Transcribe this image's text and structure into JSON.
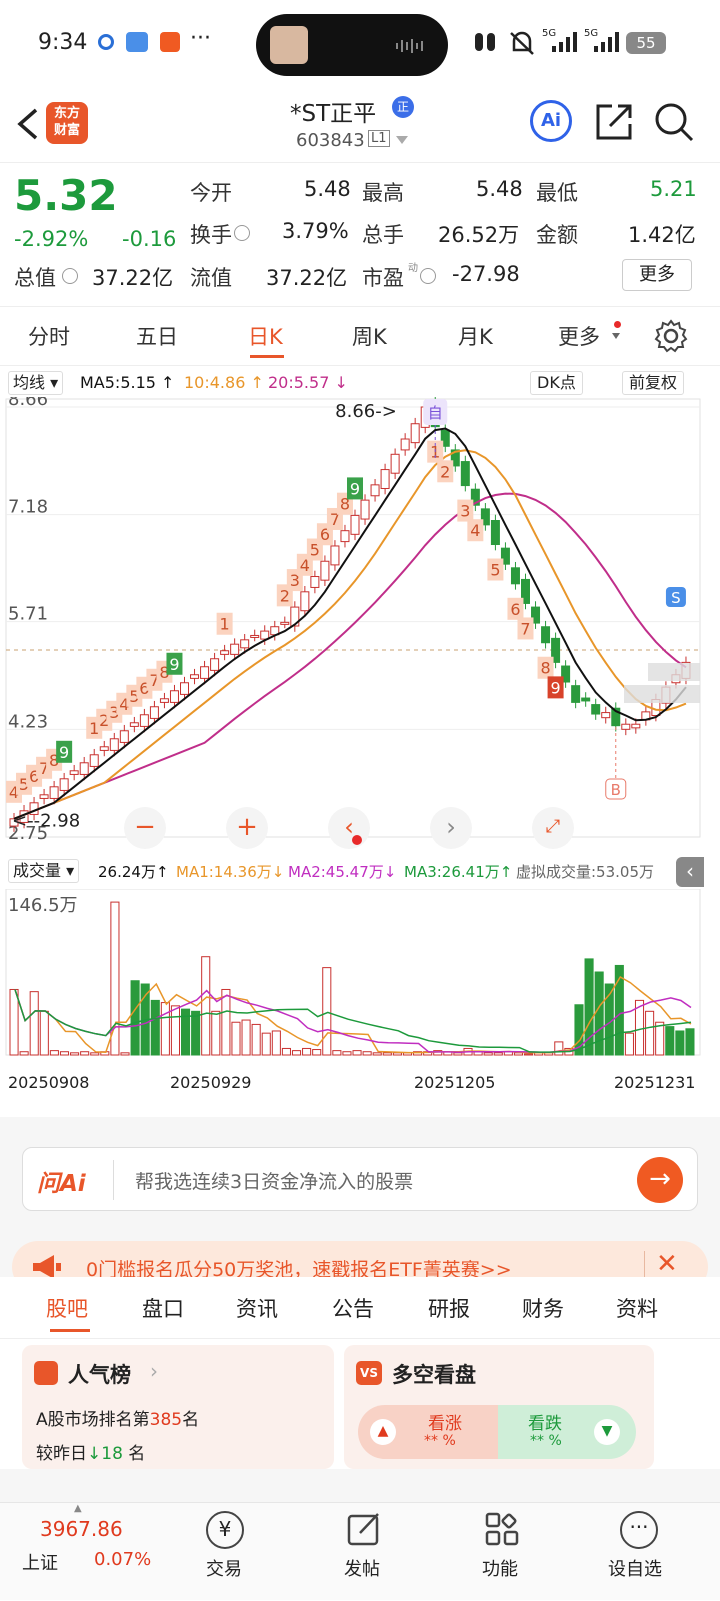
{
  "status": {
    "time": "9:34",
    "battery": "55",
    "signal1": "5G",
    "signal2": "5G"
  },
  "nav": {
    "title": "*ST正平",
    "code": "603843",
    "level": "L1",
    "badge": "正",
    "logo_line1": "东方",
    "logo_line2": "财富",
    "ai_label": "Ai"
  },
  "quote": {
    "price": "5.32",
    "pct": "-2.92%",
    "chg": "-0.16",
    "open_label": "今开",
    "open": "5.48",
    "high_label": "最高",
    "high": "5.48",
    "low_label": "最低",
    "low": "5.21",
    "turnover_label": "换手",
    "turnover": "3.79%",
    "volume_label": "总手",
    "volume": "26.52万",
    "amount_label": "金额",
    "amount": "1.42亿",
    "mcap_label": "总值",
    "mcap": "37.22亿",
    "float_label": "流值",
    "float": "37.22亿",
    "pe_label": "市盈",
    "pe_sup": "动",
    "pe": "-27.98",
    "more_label": "更多"
  },
  "tabs": [
    "分时",
    "五日",
    "日K",
    "周K",
    "月K",
    "更多"
  ],
  "active_tab": 2,
  "chart_data": {
    "type": "candlestick",
    "indicator_label": "均线",
    "ma5": "MA5:5.15",
    "ma10": "10:4.86",
    "ma20": "20:5.57",
    "dk_label": "DK点",
    "adj_label": "前复权",
    "y_ticks": [
      "8.66",
      "7.18",
      "5.71",
      "4.23",
      "2.75"
    ],
    "ylim": [
      2.75,
      8.66
    ],
    "max_label": "8.66->",
    "min_label": "<--2.98",
    "self_marker": "自",
    "s_marker": "S",
    "b_marker": "B",
    "up_counts": [
      "4",
      "5",
      "6",
      "7",
      "8",
      "9",
      "1",
      "2",
      "3",
      "4",
      "5",
      "6",
      "7",
      "8",
      "9",
      "1",
      "2",
      "3",
      "4",
      "5",
      "6",
      "7",
      "8",
      "9"
    ],
    "down_counts": [
      "1",
      "2",
      "3",
      "4",
      "5",
      "6",
      "7",
      "8",
      "9"
    ],
    "ma_colors": {
      "ma5": "#111111",
      "ma10": "#e8962a",
      "ma20": "#c02e8a"
    },
    "volume": {
      "label": "成交量",
      "value": "26.24万",
      "ma1": "MA1:14.36万",
      "ma2": "MA2:45.47万",
      "ma3": "MA3:26.41万",
      "virtual": "虚拟成交量:53.05万",
      "y_top": "146.5万"
    },
    "x_dates": [
      "20250908",
      "20250929",
      "20251205",
      "20251231"
    ]
  },
  "ask_ai": {
    "label": "问Ai",
    "placeholder": "帮我选连续3日资金净流入的股票"
  },
  "promo": {
    "text": "0门槛报名瓜分50万奖池，速戳报名ETF菁英赛>>"
  },
  "sub_tabs": [
    "股吧",
    "盘口",
    "资讯",
    "公告",
    "研报",
    "财务",
    "资料"
  ],
  "popularity": {
    "title": "人气榜",
    "line1_pre": "A股市场排名第",
    "rank": "385",
    "line1_post": "名",
    "line2_pre": "较昨日",
    "change": "18",
    "line2_post": "名"
  },
  "sentiment": {
    "title": "多空看盘",
    "bull": "看涨",
    "bear": "看跌",
    "bull_pct": "** %",
    "bear_pct": "** %"
  },
  "bottom_bar": {
    "index_value": "3967.86",
    "index_name": "上证",
    "index_pct": "0.07%",
    "trade": "交易",
    "post": "发帖",
    "func": "功能",
    "fav": "设自选"
  }
}
